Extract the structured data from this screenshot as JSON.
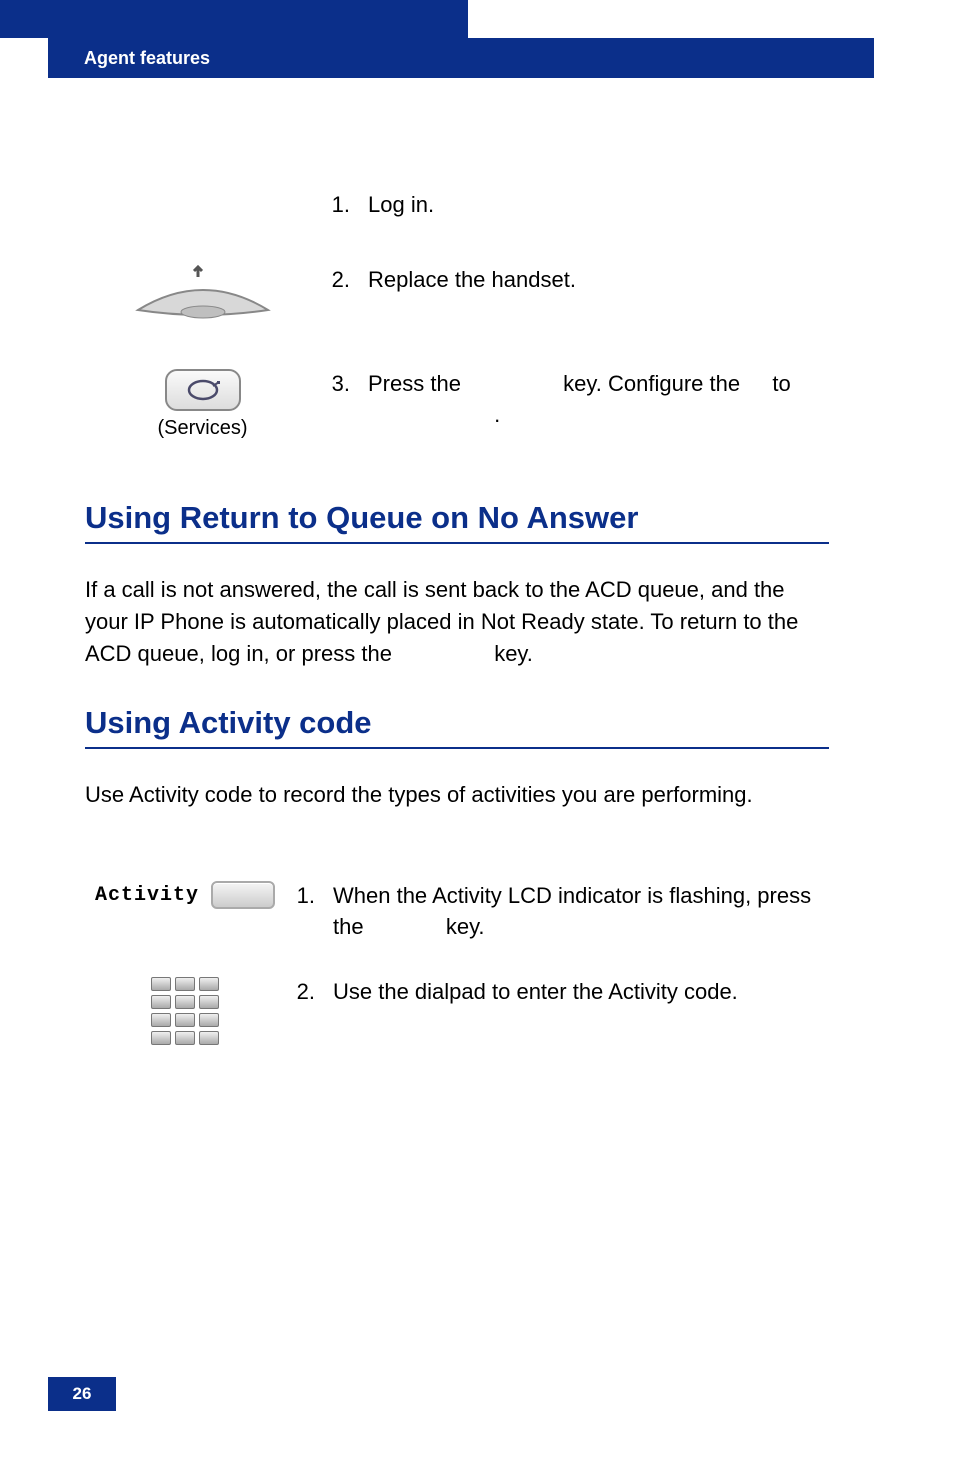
{
  "header": {
    "title": "Agent features"
  },
  "steps_top": [
    {
      "num": "1.",
      "text": "Log in."
    },
    {
      "num": "2.",
      "text": "Replace the handset."
    },
    {
      "num": "3.",
      "text_parts": [
        "Press the ",
        " key. Configure the ",
        " to ",
        "."
      ]
    }
  ],
  "services_label": "(Services)",
  "h2_1": "Using Return to Queue on No Answer",
  "para_1_parts": [
    "If a call is not answered, the call is sent back to the ACD queue, and the your IP Phone is automatically placed in Not Ready state. To return to the ACD queue, log in, or press the ",
    " key."
  ],
  "h2_2": "Using Activity code",
  "para_2": "Use Activity code to record the types of activities you are performing.",
  "activity_label": "Activity",
  "steps_bottom": [
    {
      "num": "1.",
      "text_parts": [
        "When the Activity LCD indicator is flashing, press the ",
        " key."
      ]
    },
    {
      "num": "2.",
      "text": "Use the dialpad to enter the Activity code."
    }
  ],
  "page_number": "26"
}
